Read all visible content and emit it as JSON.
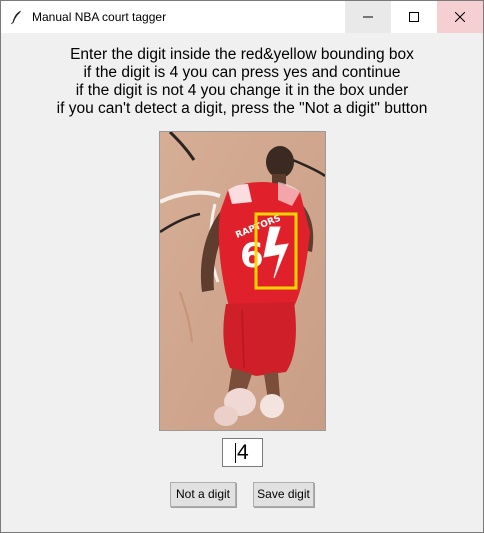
{
  "window": {
    "title": "Manual NBA court tagger",
    "icon": "feather-icon"
  },
  "titlebar_buttons": {
    "minimize": "minimize-icon",
    "maximize": "maximize-icon",
    "close": "close-icon"
  },
  "instructions": [
    "Enter the digit inside the red&yellow bounding box",
    "if the digit is 4 you can press yes and continue",
    "if the digit is not 4 you change it in the box under",
    "if you can't detect a digit, press the \"Not a digit\" button"
  ],
  "player_image": {
    "jersey_text": "6",
    "bounding_box_color": "#ffd400",
    "jersey_color": "#e0202a"
  },
  "digit_input": {
    "value": "4"
  },
  "buttons": {
    "not_a_digit": "Not a digit",
    "save_digit": "Save digit"
  }
}
